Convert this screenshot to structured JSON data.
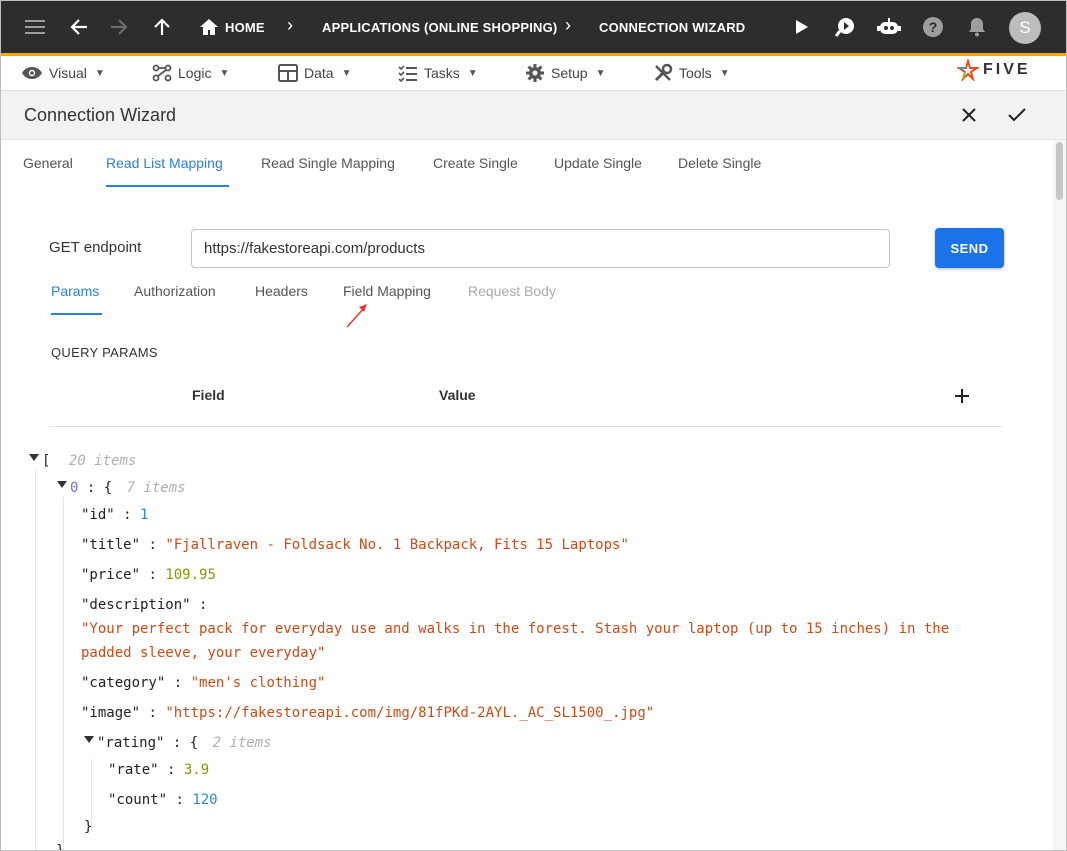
{
  "topbar": {
    "home_label": "HOME",
    "crumb_app": "APPLICATIONS (ONLINE SHOPPING)",
    "crumb_current": "CONNECTION WIZARD",
    "avatar_initial": "S"
  },
  "menubar": {
    "items": [
      {
        "label": "Visual",
        "icon": "eye-icon"
      },
      {
        "label": "Logic",
        "icon": "logic-icon"
      },
      {
        "label": "Data",
        "icon": "table-icon"
      },
      {
        "label": "Tasks",
        "icon": "tasks-icon"
      },
      {
        "label": "Setup",
        "icon": "gear-icon"
      },
      {
        "label": "Tools",
        "icon": "tools-icon"
      }
    ],
    "logo_text": "FIVE"
  },
  "page": {
    "title": "Connection Wizard"
  },
  "tabs": [
    "General",
    "Read List Mapping",
    "Read Single Mapping",
    "Create Single",
    "Update Single",
    "Delete Single"
  ],
  "endpoint": {
    "label": "GET endpoint",
    "value": "https://fakestoreapi.com/products",
    "send_label": "SEND"
  },
  "subtabs": [
    "Params",
    "Authorization",
    "Headers",
    "Field Mapping",
    "Request Body"
  ],
  "query_params": {
    "heading": "QUERY PARAMS",
    "col_field": "Field",
    "col_value": "Value"
  },
  "json_view": {
    "root_count": "20 items",
    "item_index": "0",
    "item_count": "7 items",
    "id_key": "\"id\"",
    "id_val": "1",
    "title_key": "\"title\"",
    "title_val": "\"Fjallraven - Foldsack No. 1 Backpack, Fits 15 Laptops\"",
    "price_key": "\"price\"",
    "price_val": "109.95",
    "desc_key": "\"description\"",
    "desc_val_line1": "\"Your perfect pack for everyday use and walks in the forest. Stash your laptop (up to 15 inches) in the",
    "desc_val_line2": "padded sleeve, your everyday\"",
    "category_key": "\"category\"",
    "category_val": "\"men's clothing\"",
    "image_key": "\"image\"",
    "image_val": "\"https://fakestoreapi.com/img/81fPKd-2AYL._AC_SL1500_.jpg\"",
    "rating_key": "\"rating\"",
    "rating_count": "2 items",
    "rate_key": "\"rate\"",
    "rate_val": "3.9",
    "count_key": "\"count\"",
    "count_val": "120"
  }
}
